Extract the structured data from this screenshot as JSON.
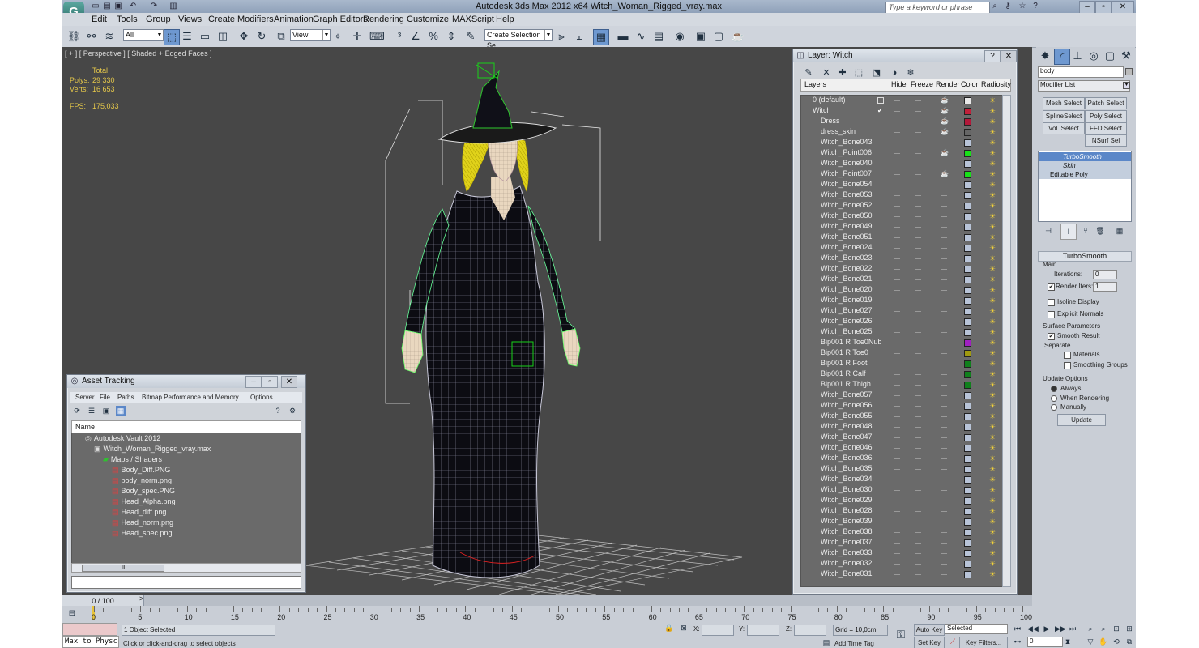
{
  "window": {
    "title": "Autodesk 3ds Max  2012 x64      Witch_Woman_Rigged_vray.max",
    "logo": "G",
    "search_placeholder": "Type a keyword or phrase"
  },
  "menu": [
    "Edit",
    "Tools",
    "Group",
    "Views",
    "Create",
    "Modifiers",
    "Animation",
    "Graph Editors",
    "Rendering",
    "Customize",
    "MAXScript",
    "Help"
  ],
  "toolbar": {
    "filter": "All",
    "ref_coord": "View",
    "selection_set": "Create Selection Se"
  },
  "viewport": {
    "label": "[ + ] [ Perspective ] [ Shaded + Edged Faces ]",
    "stats": {
      "total_label": "Total",
      "polys_label": "Polys:",
      "polys": "29 330",
      "verts_label": "Verts:",
      "verts": "16 653",
      "fps_label": "FPS:",
      "fps": "175,033"
    }
  },
  "layer_window": {
    "title": "Layer: Witch",
    "headers": {
      "layers": "Layers",
      "hide": "Hide",
      "freeze": "Freeze",
      "render": "Render",
      "color": "Color",
      "radiosity": "Radiosity"
    },
    "rows": [
      {
        "name": "0 (default)",
        "indent": 0,
        "color": "#e8e8e8",
        "render": true,
        "check": "box"
      },
      {
        "name": "Witch",
        "indent": 0,
        "color": "#c0203a",
        "render": true,
        "check": "tick"
      },
      {
        "name": "Dress",
        "indent": 1,
        "color": "#b2183a",
        "render": true
      },
      {
        "name": "dress_skin",
        "indent": 1,
        "color": "#666666",
        "render": true
      },
      {
        "name": "Witch_Bone043",
        "indent": 1,
        "color": "#b8c4d8",
        "render": false
      },
      {
        "name": "Witch_Point006",
        "indent": 1,
        "color": "#18e018",
        "render": true
      },
      {
        "name": "Witch_Bone040",
        "indent": 1,
        "color": "#b8c4d8",
        "render": false
      },
      {
        "name": "Witch_Point007",
        "indent": 1,
        "color": "#18e018",
        "render": true
      },
      {
        "name": "Witch_Bone054",
        "indent": 1,
        "color": "#b8c4d8",
        "render": false
      },
      {
        "name": "Witch_Bone053",
        "indent": 1,
        "color": "#b8c4d8",
        "render": false
      },
      {
        "name": "Witch_Bone052",
        "indent": 1,
        "color": "#b8c4d8",
        "render": false
      },
      {
        "name": "Witch_Bone050",
        "indent": 1,
        "color": "#b8c4d8",
        "render": false
      },
      {
        "name": "Witch_Bone049",
        "indent": 1,
        "color": "#b8c4d8",
        "render": false
      },
      {
        "name": "Witch_Bone051",
        "indent": 1,
        "color": "#b8c4d8",
        "render": false
      },
      {
        "name": "Witch_Bone024",
        "indent": 1,
        "color": "#b8c4d8",
        "render": false
      },
      {
        "name": "Witch_Bone023",
        "indent": 1,
        "color": "#b8c4d8",
        "render": false
      },
      {
        "name": "Witch_Bone022",
        "indent": 1,
        "color": "#b8c4d8",
        "render": false
      },
      {
        "name": "Witch_Bone021",
        "indent": 1,
        "color": "#b8c4d8",
        "render": false
      },
      {
        "name": "Witch_Bone020",
        "indent": 1,
        "color": "#b8c4d8",
        "render": false
      },
      {
        "name": "Witch_Bone019",
        "indent": 1,
        "color": "#b8c4d8",
        "render": false
      },
      {
        "name": "Witch_Bone027",
        "indent": 1,
        "color": "#b8c4d8",
        "render": false
      },
      {
        "name": "Witch_Bone026",
        "indent": 1,
        "color": "#b8c4d8",
        "render": false
      },
      {
        "name": "Witch_Bone025",
        "indent": 1,
        "color": "#b8c4d8",
        "render": false
      },
      {
        "name": "Bip001 R Toe0Nub",
        "indent": 1,
        "color": "#a020c0",
        "render": false
      },
      {
        "name": "Bip001 R Toe0",
        "indent": 1,
        "color": "#a09a10",
        "render": false
      },
      {
        "name": "Bip001 R Foot",
        "indent": 1,
        "color": "#10801c",
        "render": false
      },
      {
        "name": "Bip001 R Calf",
        "indent": 1,
        "color": "#10801c",
        "render": false
      },
      {
        "name": "Bip001 R Thigh",
        "indent": 1,
        "color": "#10801c",
        "render": false
      },
      {
        "name": "Witch_Bone057",
        "indent": 1,
        "color": "#b8c4d8",
        "render": false
      },
      {
        "name": "Witch_Bone056",
        "indent": 1,
        "color": "#b8c4d8",
        "render": false
      },
      {
        "name": "Witch_Bone055",
        "indent": 1,
        "color": "#b8c4d8",
        "render": false
      },
      {
        "name": "Witch_Bone048",
        "indent": 1,
        "color": "#b8c4d8",
        "render": false
      },
      {
        "name": "Witch_Bone047",
        "indent": 1,
        "color": "#b8c4d8",
        "render": false
      },
      {
        "name": "Witch_Bone046",
        "indent": 1,
        "color": "#b8c4d8",
        "render": false
      },
      {
        "name": "Witch_Bone036",
        "indent": 1,
        "color": "#b8c4d8",
        "render": false
      },
      {
        "name": "Witch_Bone035",
        "indent": 1,
        "color": "#b8c4d8",
        "render": false
      },
      {
        "name": "Witch_Bone034",
        "indent": 1,
        "color": "#b8c4d8",
        "render": false
      },
      {
        "name": "Witch_Bone030",
        "indent": 1,
        "color": "#b8c4d8",
        "render": false
      },
      {
        "name": "Witch_Bone029",
        "indent": 1,
        "color": "#b8c4d8",
        "render": false
      },
      {
        "name": "Witch_Bone028",
        "indent": 1,
        "color": "#b8c4d8",
        "render": false
      },
      {
        "name": "Witch_Bone039",
        "indent": 1,
        "color": "#b8c4d8",
        "render": false
      },
      {
        "name": "Witch_Bone038",
        "indent": 1,
        "color": "#b8c4d8",
        "render": false
      },
      {
        "name": "Witch_Bone037",
        "indent": 1,
        "color": "#b8c4d8",
        "render": false
      },
      {
        "name": "Witch_Bone033",
        "indent": 1,
        "color": "#b8c4d8",
        "render": false
      },
      {
        "name": "Witch_Bone032",
        "indent": 1,
        "color": "#b8c4d8",
        "render": false
      },
      {
        "name": "Witch_Bone031",
        "indent": 1,
        "color": "#b8c4d8",
        "render": false
      }
    ]
  },
  "asset_tracking": {
    "title": "Asset Tracking",
    "menu": [
      "Server",
      "File",
      "Paths",
      "Bitmap Performance and Memory",
      "Options"
    ],
    "column": "Name",
    "items": [
      {
        "name": "Autodesk Vault 2012",
        "indent": 0
      },
      {
        "name": "Witch_Woman_Rigged_vray.max",
        "indent": 1
      },
      {
        "name": "Maps / Shaders",
        "indent": 2
      },
      {
        "name": "Body_Diff.PNG",
        "indent": 3
      },
      {
        "name": "body_norm.png",
        "indent": 3
      },
      {
        "name": "Body_spec.PNG",
        "indent": 3
      },
      {
        "name": "Head_Alpha.png",
        "indent": 3
      },
      {
        "name": "Head_diff.png",
        "indent": 3
      },
      {
        "name": "Head_norm.png",
        "indent": 3
      },
      {
        "name": "Head_spec.png",
        "indent": 3
      }
    ],
    "scroll_thumb": "III"
  },
  "command_panel": {
    "object_name": "body",
    "modifier_list": "Modifier List",
    "buttons": [
      "Mesh Select",
      "Patch Select",
      "SplineSelect",
      "Poly Select",
      "Vol. Select",
      "FFD Select",
      "NSurf Sel"
    ],
    "stack": [
      "TurboSmooth",
      "Skin",
      "Editable Poly"
    ],
    "turbosmooth": {
      "title": "TurboSmooth",
      "main": "Main",
      "iterations_label": "Iterations:",
      "iterations": "0",
      "render_iters_label": "Render Iters:",
      "render_iters": "1",
      "isoline": "Isoline Display",
      "explicit": "Explicit Normals",
      "surface": "Surface Parameters",
      "smooth_result": "Smooth Result",
      "separate": "Separate",
      "materials": "Materials",
      "smoothing_groups": "Smoothing Groups",
      "update_options": "Update Options",
      "always": "Always",
      "when_rendering": "When Rendering",
      "manually": "Manually",
      "update": "Update"
    }
  },
  "timeline": {
    "frame": "0 / 100",
    "ticks": [
      "0",
      "5",
      "10",
      "15",
      "20",
      "25",
      "30",
      "35",
      "40",
      "45",
      "50",
      "55",
      "60",
      "65",
      "70",
      "75",
      "80",
      "85",
      "90",
      "95",
      "100"
    ]
  },
  "status": {
    "maxscript": "Max to Physc",
    "selected": "1 Object Selected",
    "prompt": "Click or click-and-drag to select objects",
    "x_label": "X:",
    "y_label": "Y:",
    "z_label": "Z:",
    "grid": "Grid = 10,0cm",
    "add_time_tag": "Add Time Tag",
    "auto_key": "Auto Key",
    "set_key": "Set Key",
    "selected_dd": "Selected",
    "key_filters": "Key Filters...",
    "frame_value": "0"
  }
}
